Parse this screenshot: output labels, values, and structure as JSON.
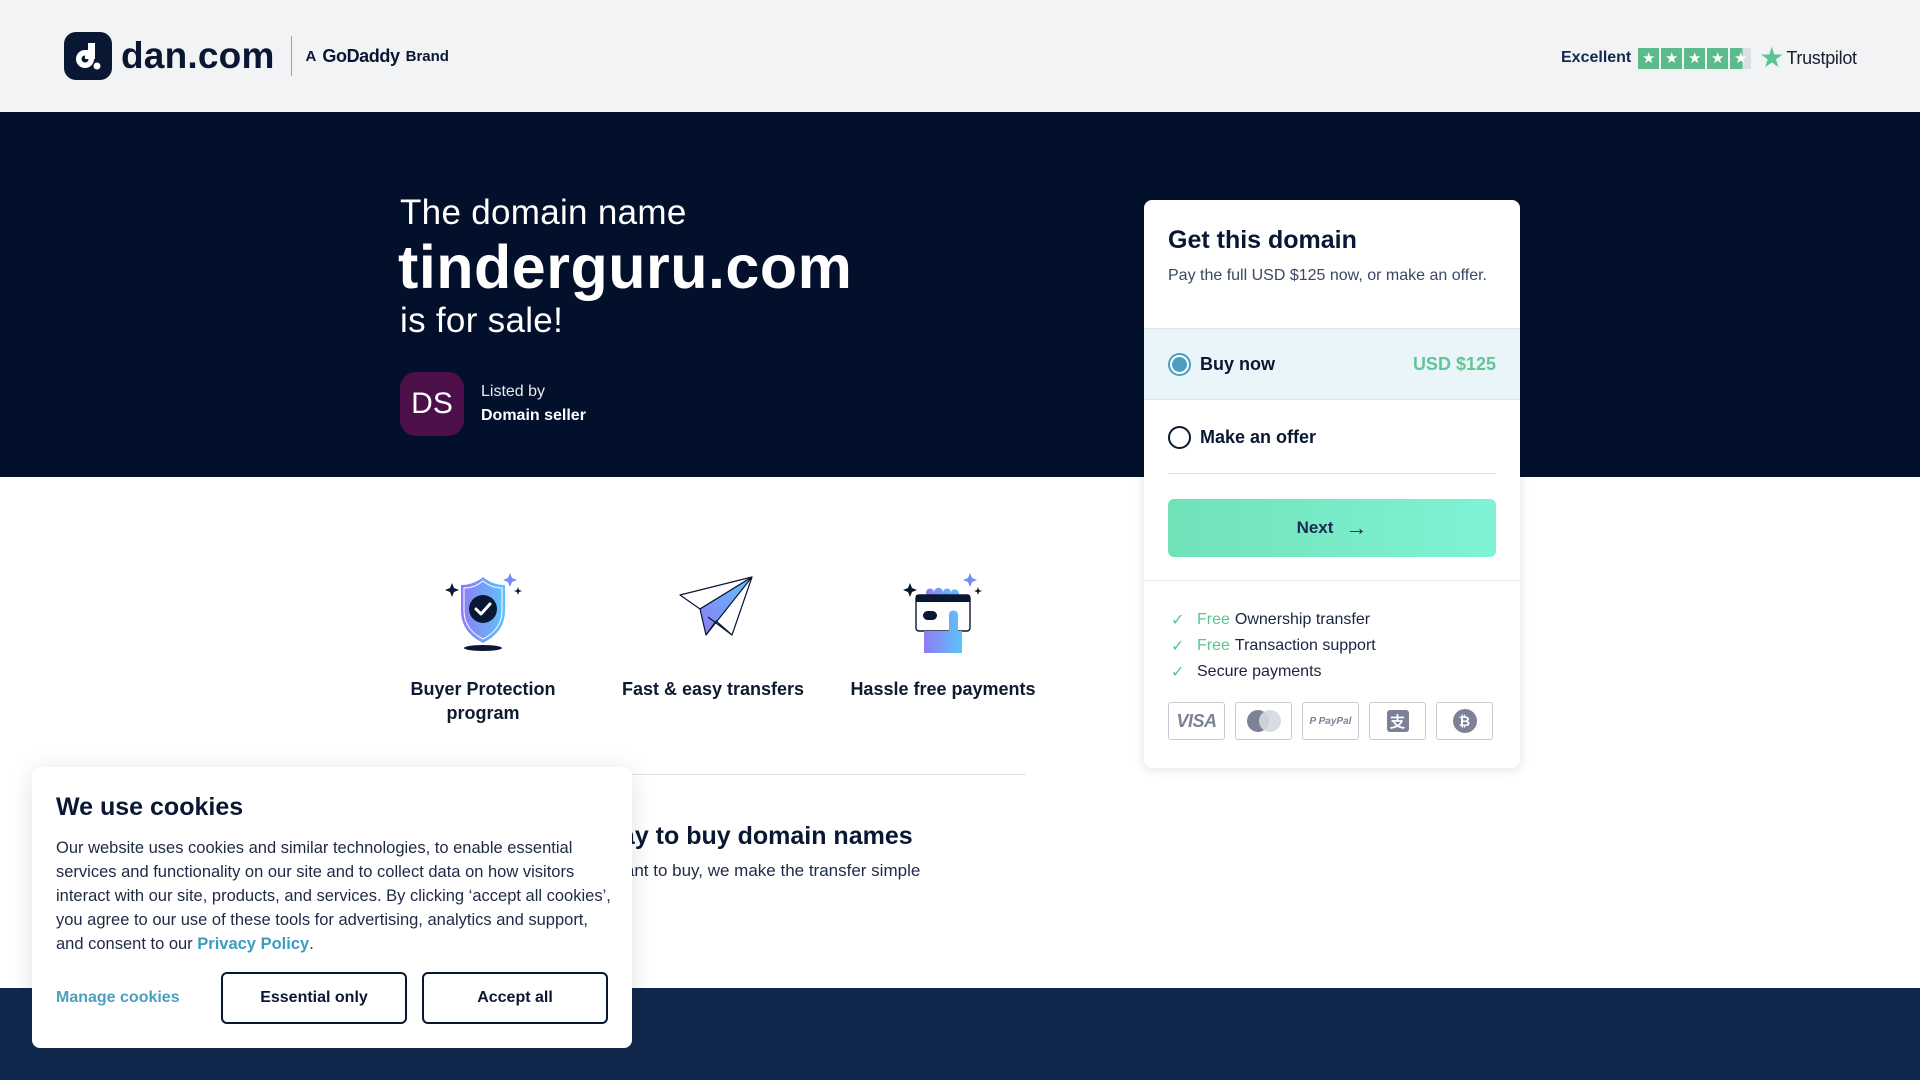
{
  "header": {
    "logo_text": "dan.com",
    "brand_prefix": "A",
    "brand_name": "GoDaddy",
    "brand_suffix": "Brand",
    "trustpilot": {
      "rating_label": "Excellent",
      "stars": 4.5,
      "star_glyph": "★",
      "name": "Trustpilot"
    }
  },
  "hero": {
    "intro": "The domain name",
    "domain": "tinderguru.com",
    "outro": "is for sale!",
    "seller": {
      "initials": "DS",
      "listed_by": "Listed by",
      "name": "Domain seller"
    }
  },
  "purchase_card": {
    "title": "Get this domain",
    "description": "Pay the full USD $125 now, or make an offer.",
    "options": [
      {
        "label": "Buy now",
        "price": "USD $125",
        "selected": true
      },
      {
        "label": "Make an offer",
        "price": "",
        "selected": false
      }
    ],
    "next_label": "Next",
    "next_arrow": "→",
    "perks": [
      {
        "prefix": "Free",
        "text": "Ownership transfer"
      },
      {
        "prefix": "Free",
        "text": "Transaction support"
      },
      {
        "prefix": "",
        "text": "Secure payments"
      }
    ],
    "check_glyph": "✓",
    "payment_methods": [
      {
        "name": "visa-icon",
        "label": "VISA"
      },
      {
        "name": "mastercard-icon",
        "label": ""
      },
      {
        "name": "paypal-icon",
        "label": "P PayPal"
      },
      {
        "name": "alipay-icon",
        "label": "支"
      },
      {
        "name": "bitcoin-icon",
        "label": "₿"
      }
    ]
  },
  "features": [
    {
      "icon": "shield-check-icon",
      "label": "Buyer Protection program"
    },
    {
      "icon": "paper-plane-icon",
      "label": "Fast & easy transfers"
    },
    {
      "icon": "card-hand-icon",
      "label": "Hassle free payments"
    }
  ],
  "buy_section": {
    "heading": "The simple, safe way to buy domain names",
    "text": "No matter what domain you want to buy, we make the transfer simple"
  },
  "cookie_banner": {
    "title": "We use cookies",
    "body": "Our website uses cookies and similar technologies, to enable essential services and functionality on our site and to collect data on how visitors interact with our site, products, and services. By clicking ‘accept all cookies’, you agree to our use of these tools for advertising, analytics and support, and consent to our ",
    "privacy_link": "Privacy Policy",
    "body_end": ".",
    "manage_label": "Manage cookies",
    "essential_label": "Essential only",
    "accept_label": "Accept all"
  },
  "colors": {
    "hero_bg": "#02102b",
    "footer_bg": "#10284d",
    "accent_green": "#62c597",
    "accent_blue": "#4a9fc0",
    "avatar_bg": "#4c0f4a"
  }
}
